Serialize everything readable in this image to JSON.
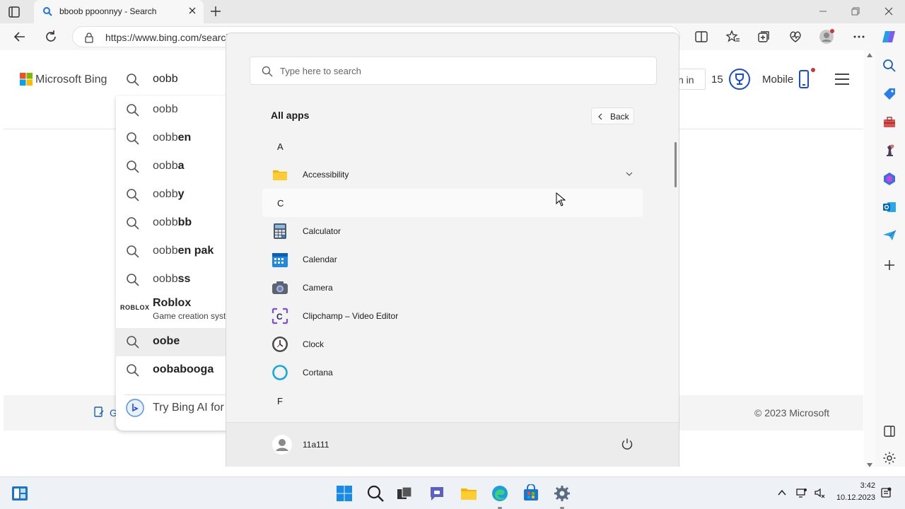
{
  "browser": {
    "tab_title": "bboob ppoonnyy - Search",
    "url": "https://www.bing.com/search"
  },
  "bing": {
    "logo_text": "Microsoft Bing",
    "signin_label": "n in",
    "points": "15",
    "mobile_label": "Mobile",
    "copyright": "© 2023 Microsoft",
    "footer_link": "G"
  },
  "search": {
    "query": "oobb",
    "suggestions": [
      {
        "prefix": "oobb",
        "bold": ""
      },
      {
        "prefix": "oobb",
        "bold": "en"
      },
      {
        "prefix": "oobb",
        "bold": "a"
      },
      {
        "prefix": "oobb",
        "bold": "y"
      },
      {
        "prefix": "oobb",
        "bold": "bb"
      },
      {
        "prefix": "oobb",
        "bold": "en pak"
      },
      {
        "prefix": "oobb",
        "bold": "ss"
      }
    ],
    "entity": {
      "logo": "ROBLOX",
      "title": "Roblox",
      "subtitle": "Game creation syst"
    },
    "more_suggestions": [
      {
        "prefix": "",
        "bold": "oobe"
      },
      {
        "prefix": "",
        "bold": "oobabooga"
      }
    ],
    "try_bing": "Try Bing AI for"
  },
  "start_menu": {
    "search_placeholder": "Type here to search",
    "title": "All apps",
    "back_label": "Back",
    "groups": [
      {
        "letter": "A",
        "apps": [
          {
            "name": "Accessibility",
            "icon": "folder-icon",
            "expandable": true
          }
        ]
      },
      {
        "letter": "C",
        "apps": [
          {
            "name": "Calculator",
            "icon": "calculator-icon"
          },
          {
            "name": "Calendar",
            "icon": "calendar-icon"
          },
          {
            "name": "Camera",
            "icon": "camera-icon"
          },
          {
            "name": "Clipchamp – Video Editor",
            "icon": "clipchamp-icon"
          },
          {
            "name": "Clock",
            "icon": "clock-icon"
          },
          {
            "name": "Cortana",
            "icon": "cortana-icon"
          }
        ]
      },
      {
        "letter": "F",
        "apps": []
      }
    ],
    "user_name": "11a111"
  },
  "taskbar": {
    "time": "3:42",
    "date": "10.12.2023"
  },
  "colors": {
    "accent": "#0067c0",
    "bing_blue": "#174ae4",
    "notification": "#d13438"
  }
}
